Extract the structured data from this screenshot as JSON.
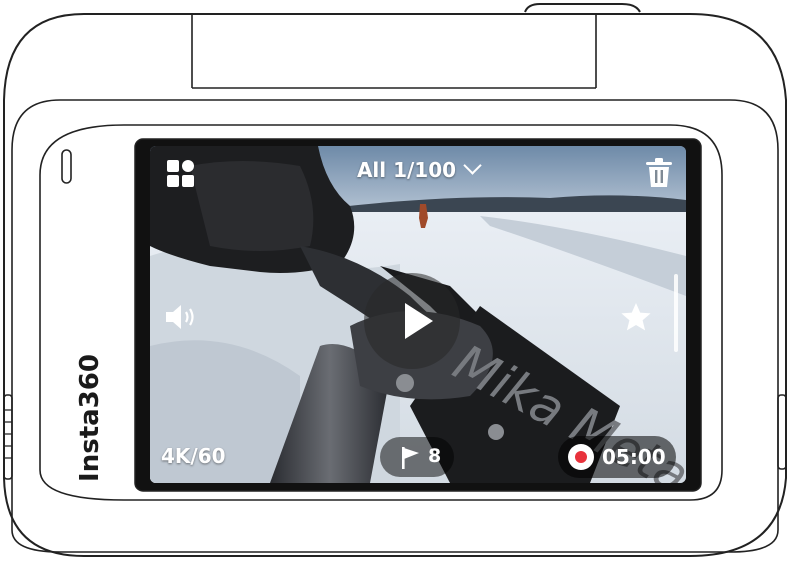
{
  "device": {
    "brand": "Insta360"
  },
  "screen": {
    "album_title": "All 1/100",
    "resolution": "4K/60",
    "marker_count": "8",
    "duration": "05:00",
    "icons": {
      "gallery": "grid-gallery-icon",
      "delete": "trash-icon",
      "volume": "speaker-icon",
      "favorite": "star-icon",
      "play": "play-icon",
      "marker": "flag-icon",
      "record": "record-dot-icon"
    },
    "video_overlay_text": "Mika Metals"
  },
  "colors": {
    "record_dot": "#e8323c",
    "pill_background": "#00000080",
    "ui_text": "#ffffff"
  }
}
